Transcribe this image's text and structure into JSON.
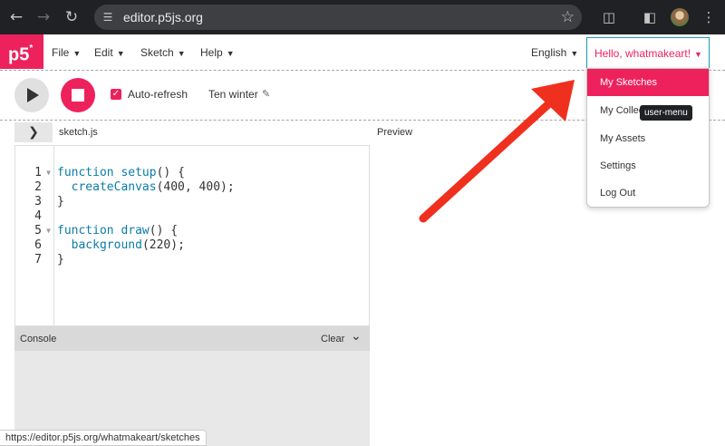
{
  "browser": {
    "url": "editor.p5js.org",
    "status_url": "https://editor.p5js.org/whatmakeart/sketches"
  },
  "nav": {
    "logo": "p5",
    "logo_mark": "*",
    "menus": [
      "File",
      "Edit",
      "Sketch",
      "Help"
    ],
    "language": "English",
    "greeting": "Hello, whatmakeart!"
  },
  "toolbar": {
    "auto_refresh_label": "Auto-refresh",
    "auto_refresh_checked": true,
    "sketch_name": "Ten winter"
  },
  "editor": {
    "file_name": "sketch.js",
    "line_numbers": [
      "1",
      "2",
      "3",
      "4",
      "5",
      "6",
      "7"
    ],
    "code": [
      [
        {
          "t": "function ",
          "c": "kw"
        },
        {
          "t": "setup",
          "c": "fn"
        },
        {
          "t": "() {",
          "c": ""
        }
      ],
      [
        {
          "t": "  ",
          "c": ""
        },
        {
          "t": "createCanvas",
          "c": "fn"
        },
        {
          "t": "(400, 400);",
          "c": ""
        }
      ],
      [
        {
          "t": "}",
          "c": ""
        }
      ],
      [
        {
          "t": "",
          "c": ""
        }
      ],
      [
        {
          "t": "function ",
          "c": "kw"
        },
        {
          "t": "draw",
          "c": "fn"
        },
        {
          "t": "() {",
          "c": ""
        }
      ],
      [
        {
          "t": "  ",
          "c": ""
        },
        {
          "t": "background",
          "c": "fn"
        },
        {
          "t": "(220);",
          "c": ""
        }
      ],
      [
        {
          "t": "}",
          "c": ""
        }
      ]
    ]
  },
  "preview": {
    "label": "Preview"
  },
  "console": {
    "title": "Console",
    "clear_label": "Clear"
  },
  "user_menu": {
    "items": [
      "My Sketches",
      "My Collections",
      "My Assets",
      "Settings",
      "Log Out"
    ],
    "active": "My Sketches",
    "tooltip": "user-menu"
  },
  "colors": {
    "accent": "#ed225d",
    "focus": "#1a9bb4",
    "annotation_arrow": "#f0301e"
  }
}
